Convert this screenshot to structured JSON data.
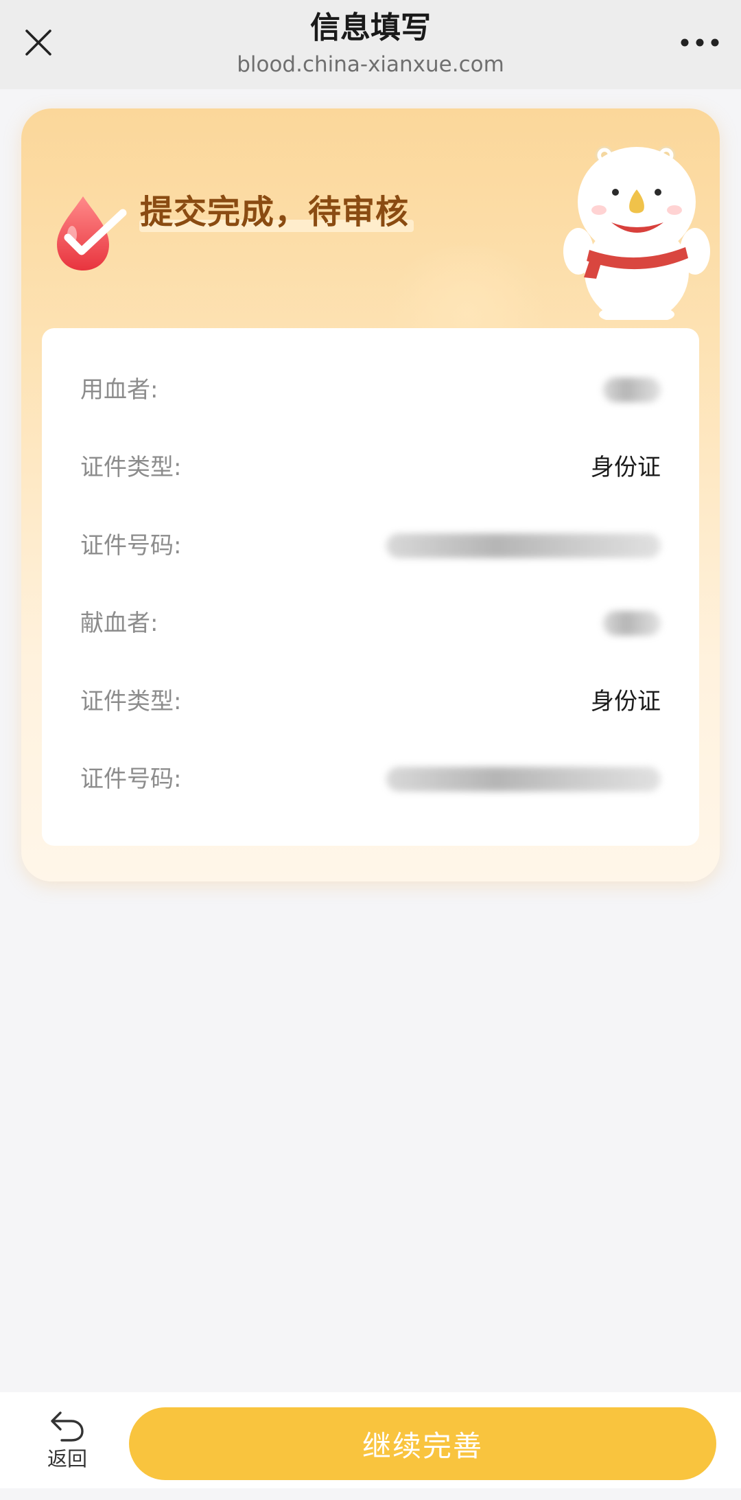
{
  "header": {
    "title": "信息填写",
    "url": "blood.china-xianxue.com",
    "close_icon": "close-icon",
    "more_icon": "more-dots-icon"
  },
  "card": {
    "status_title": "提交完成，待审核",
    "status_icon": "check-blood-drop-icon",
    "mascot": "polar-bear-mascot",
    "rows": [
      {
        "label": "用血者:",
        "value": "",
        "masked": true
      },
      {
        "label": "证件类型:",
        "value": "身份证",
        "masked": false
      },
      {
        "label": "证件号码:",
        "value": "",
        "masked": true
      },
      {
        "label": "献血者:",
        "value": "",
        "masked": true
      },
      {
        "label": "证件类型:",
        "value": "身份证",
        "masked": false
      },
      {
        "label": "证件号码:",
        "value": "",
        "masked": true
      }
    ]
  },
  "bottom": {
    "back_label": "返回",
    "back_icon": "undo-arrow-icon",
    "continue_label": "继续完善"
  },
  "colors": {
    "accent": "#f9c43e",
    "status_text": "#8a4b12",
    "card_top": "#fbd79a",
    "page_bg": "#f5f5f7"
  }
}
